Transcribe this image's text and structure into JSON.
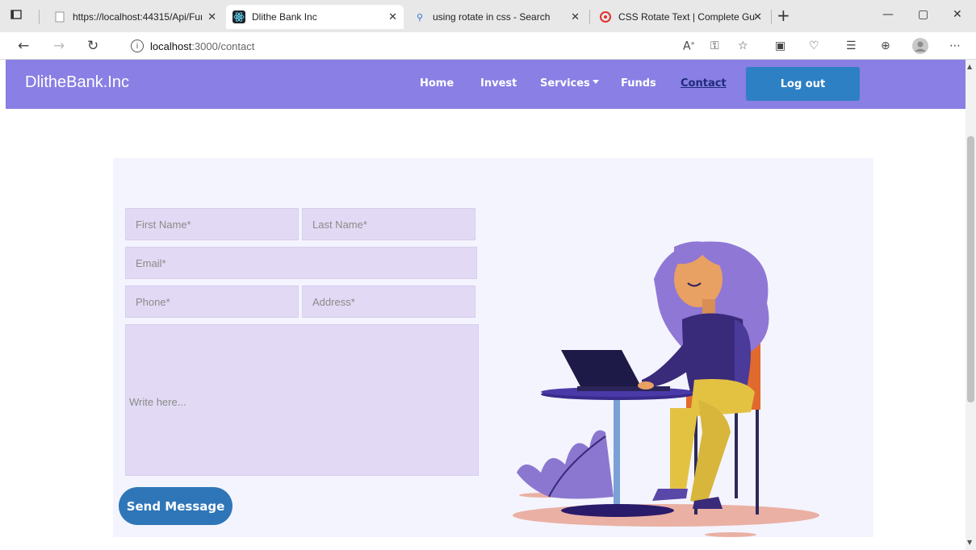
{
  "browser": {
    "tabs": [
      {
        "title": "https://localhost:44315/Api/Func",
        "active": false
      },
      {
        "title": "Dlithe Bank Inc",
        "active": true
      },
      {
        "title": "using rotate in css - Search",
        "active": false
      },
      {
        "title": "CSS Rotate Text | Complete Guid",
        "active": false
      }
    ],
    "url_host": "localhost",
    "url_path": ":3000/contact"
  },
  "navbar": {
    "brand": "DlitheBank.Inc",
    "links": [
      "Home",
      "Invest",
      "Services",
      "Funds",
      "Contact"
    ],
    "active_link": "Contact",
    "logout_label": "Log out"
  },
  "form": {
    "first_name_placeholder": "First Name*",
    "last_name_placeholder": "Last Name*",
    "email_placeholder": "Email*",
    "phone_placeholder": "Phone*",
    "address_placeholder": "Address*",
    "message_placeholder": "Write here...",
    "send_label": "Send Message"
  },
  "colors": {
    "navbar": "#8a7fe4",
    "button": "#2e76b8",
    "field": "#e2daf4",
    "card": "#f4f4fe"
  }
}
